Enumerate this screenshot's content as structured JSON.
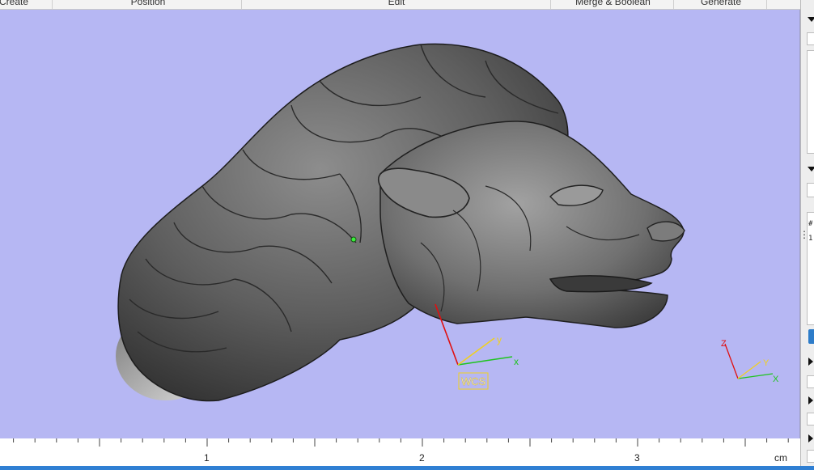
{
  "menu": {
    "items": [
      {
        "label": "Create"
      },
      {
        "label": "Position"
      },
      {
        "label": "Edit"
      },
      {
        "label": "Merge & Boolean"
      },
      {
        "label": "Generate"
      }
    ]
  },
  "viewport": {
    "background": "#b6b7f3",
    "model": "lion-head-sculpture",
    "wcs": {
      "label": "WCS",
      "x_label": "x",
      "y_label": "y"
    },
    "triad": {
      "x_label": "X",
      "y_label": "Y",
      "z_label": "Z"
    }
  },
  "ruler": {
    "labels": [
      "1",
      "2",
      "3"
    ],
    "unit": "cm"
  },
  "side_panel": {
    "text_lines": [
      "#",
      "1"
    ]
  }
}
